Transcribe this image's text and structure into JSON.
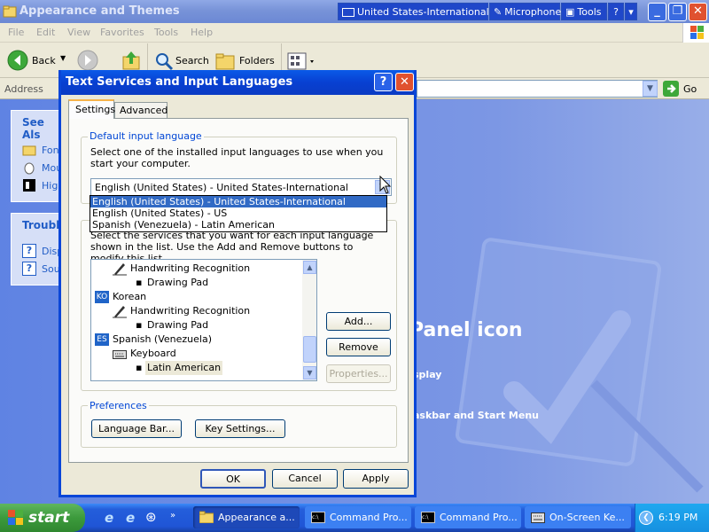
{
  "window": {
    "title": "Appearance and Themes"
  },
  "language_bar": {
    "language": "United States-International",
    "microphone": "Microphone",
    "tools": "Tools",
    "help": "?"
  },
  "menu": [
    "File",
    "Edit",
    "View",
    "Favorites",
    "Tools",
    "Help"
  ],
  "toolbar": {
    "back": "Back",
    "search": "Search",
    "folders": "Folders"
  },
  "address": {
    "label": "Address",
    "go": "Go"
  },
  "sidebar": {
    "see_also": {
      "title": "See Als",
      "items": [
        "Fon",
        "Mou",
        "High"
      ]
    },
    "troubleshooters": {
      "title": "Trouble",
      "items": [
        "Disp",
        "Sou"
      ]
    }
  },
  "background": {
    "heading": "Panel icon",
    "link1": "splay",
    "link2": "askbar and Start Menu"
  },
  "dialog": {
    "title": "Text Services and Input Languages",
    "tabs": [
      "Settings",
      "Advanced"
    ],
    "default_group": {
      "legend": "Default input language",
      "description": "Select one of the installed input languages to use when you start your computer.",
      "selected": "English (United States) - United States-International"
    },
    "dropdown_options": [
      "English (United States) - United States-International",
      "English (United States) - US",
      "Spanish (Venezuela) - Latin American"
    ],
    "services_group": {
      "description": "Select the services that you want for each input language shown in the list. Use the Add and Remove buttons to modify this list."
    },
    "tree": [
      {
        "level": 1,
        "icon": "pen",
        "label": "Handwriting Recognition"
      },
      {
        "level": 2,
        "icon": "bullet",
        "label": "Drawing Pad"
      },
      {
        "level": 0,
        "icon": "KO",
        "label": "Korean"
      },
      {
        "level": 1,
        "icon": "pen",
        "label": "Handwriting Recognition"
      },
      {
        "level": 2,
        "icon": "bullet",
        "label": "Drawing Pad"
      },
      {
        "level": 0,
        "icon": "ES",
        "label": "Spanish (Venezuela)"
      },
      {
        "level": 1,
        "icon": "keyboard",
        "label": "Keyboard"
      },
      {
        "level": 2,
        "icon": "bullet",
        "label": "Latin American"
      }
    ],
    "buttons": {
      "add": "Add...",
      "remove": "Remove",
      "properties": "Properties..."
    },
    "preferences": {
      "legend": "Preferences",
      "language_bar": "Language Bar...",
      "key_settings": "Key Settings..."
    },
    "footer": {
      "ok": "OK",
      "cancel": "Cancel",
      "apply": "Apply"
    }
  },
  "taskbar": {
    "start": "start",
    "tasks": [
      "Appearance a...",
      "Command Pro...",
      "Command Pro...",
      "On-Screen Ke..."
    ],
    "clock": "6:19 PM"
  }
}
